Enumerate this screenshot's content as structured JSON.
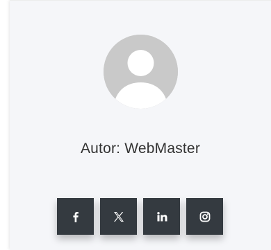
{
  "author": {
    "label": "Autor: WebMaster"
  },
  "avatar": {
    "icon": "default-user-icon",
    "bg_color": "#c9c9c9",
    "fg_color": "#ffffff"
  },
  "social": {
    "button_color": "#343a40",
    "icon_color": "#ffffff",
    "items": [
      {
        "network": "facebook",
        "icon": "facebook-icon"
      },
      {
        "network": "x",
        "icon": "x-icon"
      },
      {
        "network": "linkedin",
        "icon": "linkedin-icon"
      },
      {
        "network": "instagram",
        "icon": "instagram-icon"
      }
    ]
  }
}
